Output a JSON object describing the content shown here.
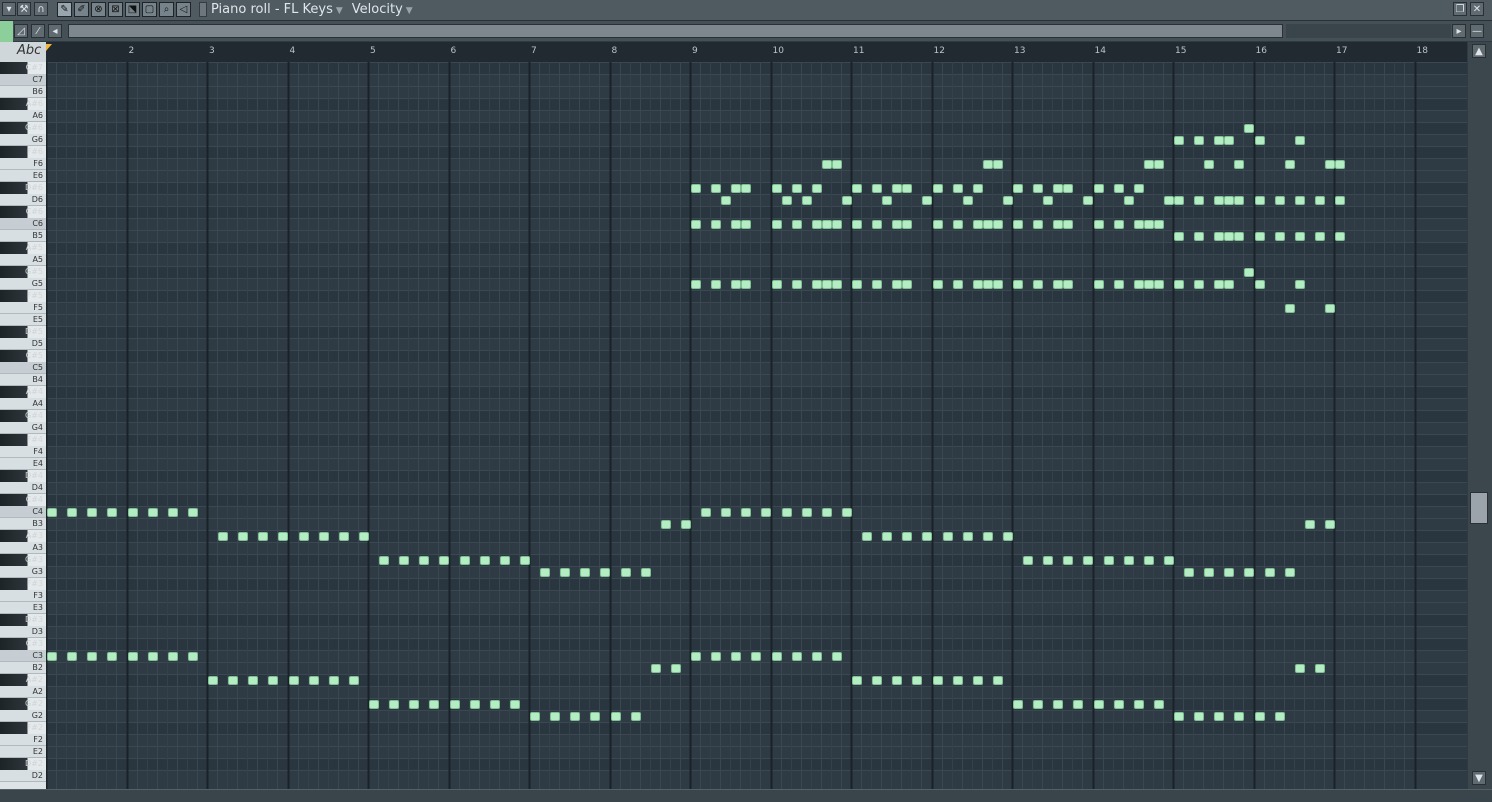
{
  "window": {
    "title": "Piano roll - FL Keys",
    "mode": "Velocity"
  },
  "colors": {
    "note": "#b4ecc4",
    "grid_bg": "#2e3b45",
    "accent": "#8ccf9a"
  },
  "ruler": {
    "bars": [
      "2",
      "3",
      "4",
      "5",
      "6",
      "7",
      "8",
      "9",
      "10",
      "11",
      "12",
      "13",
      "14",
      "15",
      "16",
      "17",
      "18"
    ]
  },
  "keyboard": {
    "label": "Abc",
    "keys": [
      "C#7",
      "C7",
      "B6",
      "A#6",
      "A6",
      "G#6",
      "G6",
      "F#6",
      "F6",
      "E6",
      "D#6",
      "D6",
      "C#6",
      "C6",
      "B5",
      "A#5",
      "A5",
      "G#5",
      "G5",
      "F#5",
      "F5",
      "E5",
      "D#5",
      "D5",
      "C#5",
      "C5",
      "B4",
      "A#4",
      "A4",
      "G#4",
      "G4",
      "F#4",
      "F4",
      "E4",
      "D#4",
      "D4",
      "C#4",
      "C4",
      "B3",
      "A#3",
      "A3",
      "G#3",
      "G3",
      "F#3",
      "F3",
      "E3",
      "D#3",
      "D3",
      "C#3",
      "C3",
      "B2",
      "A#2",
      "A2",
      "G#2",
      "G2",
      "F#2",
      "F2",
      "E2",
      "D#2",
      "D2"
    ]
  },
  "notes": [
    {
      "row": 37,
      "starts": [
        1,
        1.25,
        1.5,
        1.75,
        2,
        2.25,
        2.5,
        2.75
      ]
    },
    {
      "row": 49,
      "starts": [
        1,
        1.25,
        1.5,
        1.75,
        2,
        2.25,
        2.5,
        2.75
      ]
    },
    {
      "row": 39,
      "starts": [
        3.125,
        3.375,
        3.625,
        3.875,
        4.125,
        4.375,
        4.625,
        4.875
      ]
    },
    {
      "row": 51,
      "starts": [
        3,
        3.25,
        3.5,
        3.75,
        4,
        4.25,
        4.5,
        4.75
      ]
    },
    {
      "row": 41,
      "starts": [
        5.125,
        5.375,
        5.625,
        5.875,
        6.125,
        6.375,
        6.625,
        6.875
      ]
    },
    {
      "row": 53,
      "starts": [
        5,
        5.25,
        5.5,
        5.75,
        6,
        6.25,
        6.5,
        6.75
      ]
    },
    {
      "row": 42,
      "starts": [
        7.125,
        7.375,
        7.625,
        7.875,
        8.125,
        8.375
      ]
    },
    {
      "row": 54,
      "starts": [
        7,
        7.25,
        7.5,
        7.75,
        8,
        8.25
      ]
    },
    {
      "row": 38,
      "starts": [
        8.625,
        8.875
      ]
    },
    {
      "row": 50,
      "starts": [
        8.5,
        8.75
      ]
    },
    {
      "row": 37,
      "starts": [
        9.125,
        9.375,
        9.625,
        9.875,
        10.125,
        10.375,
        10.625,
        10.875
      ]
    },
    {
      "row": 49,
      "starts": [
        9,
        9.25,
        9.5,
        9.75,
        10,
        10.25,
        10.5,
        10.75
      ]
    },
    {
      "row": 39,
      "starts": [
        11.125,
        11.375,
        11.625,
        11.875,
        12.125,
        12.375,
        12.625,
        12.875
      ]
    },
    {
      "row": 51,
      "starts": [
        11,
        11.25,
        11.5,
        11.75,
        12,
        12.25,
        12.5,
        12.75
      ]
    },
    {
      "row": 41,
      "starts": [
        13.125,
        13.375,
        13.625,
        13.875,
        14.125,
        14.375,
        14.625,
        14.875
      ]
    },
    {
      "row": 53,
      "starts": [
        13,
        13.25,
        13.5,
        13.75,
        14,
        14.25,
        14.5,
        14.75
      ]
    },
    {
      "row": 42,
      "starts": [
        15.125,
        15.375,
        15.625,
        15.875,
        16.125,
        16.375
      ]
    },
    {
      "row": 54,
      "starts": [
        15,
        15.25,
        15.5,
        15.75,
        16,
        16.25
      ]
    },
    {
      "row": 38,
      "starts": [
        16.625,
        16.875
      ]
    },
    {
      "row": 50,
      "starts": [
        16.5,
        16.75
      ]
    },
    {
      "row": 10,
      "starts": [
        9,
        9.25,
        9.5,
        9.625,
        10,
        10.25,
        10.5,
        11,
        11.25,
        11.5,
        11.625,
        12,
        12.25,
        12.5,
        13,
        13.25,
        13.5,
        13.625,
        14,
        14.25,
        14.5
      ]
    },
    {
      "row": 11,
      "starts": [
        9.375,
        10.125,
        10.375,
        10.875,
        11.375,
        11.875,
        12.375,
        12.875,
        13.375,
        13.875,
        14.375,
        14.875,
        15,
        15.25,
        15.5,
        15.625,
        15.75,
        16,
        16.25,
        16.5,
        16.75,
        17
      ]
    },
    {
      "row": 13,
      "starts": [
        9,
        9.25,
        9.5,
        9.625,
        10,
        10.25,
        10.5,
        10.625,
        10.75,
        11,
        11.25,
        11.5,
        11.625,
        12,
        12.25,
        12.5,
        12.625,
        12.75,
        13,
        13.25,
        13.5,
        13.625,
        14,
        14.25,
        14.5,
        14.625,
        14.75
      ]
    },
    {
      "row": 14,
      "starts": [
        15,
        15.25,
        15.5,
        15.625,
        15.75,
        16,
        16.25,
        16.5,
        16.75,
        17
      ]
    },
    {
      "row": 18,
      "starts": [
        9,
        9.25,
        9.5,
        9.625,
        10,
        10.25,
        10.5,
        10.625,
        10.75,
        11,
        11.25,
        11.5,
        11.625,
        12,
        12.25,
        12.5,
        12.625,
        12.75,
        13,
        13.25,
        13.5,
        13.625,
        14,
        14.25,
        14.5,
        14.625,
        14.75,
        15,
        15.25,
        15.5,
        15.625,
        16,
        16.5
      ]
    },
    {
      "row": 8,
      "starts": [
        10.625,
        10.75,
        12.625,
        12.75,
        14.625,
        14.75,
        15.375,
        15.75,
        16.375,
        16.875,
        17
      ]
    },
    {
      "row": 6,
      "starts": [
        15,
        15.25,
        15.5,
        15.625,
        16,
        16.5
      ]
    },
    {
      "row": 5,
      "starts": [
        15.875
      ]
    },
    {
      "row": 17,
      "starts": [
        15.875
      ]
    },
    {
      "row": 20,
      "starts": [
        16.375,
        16.875
      ]
    }
  ]
}
